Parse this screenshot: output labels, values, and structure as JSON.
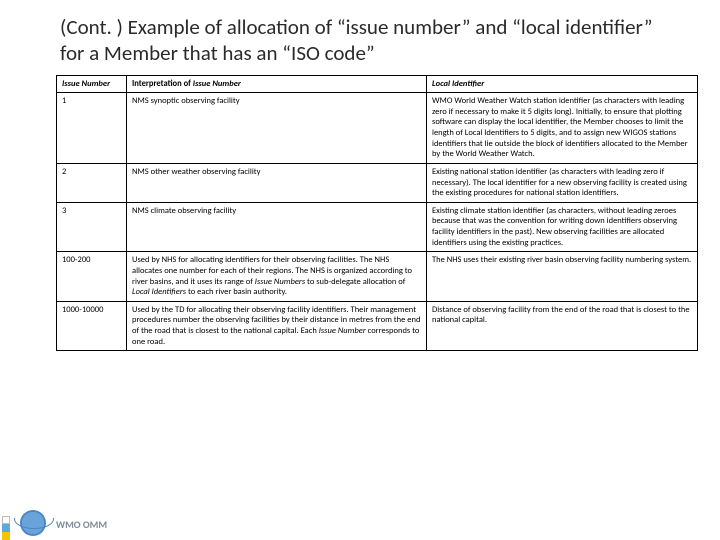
{
  "title": "(Cont. ) Example of allocation of “issue number” and “local identifier” for a Member that has an “ISO code”",
  "headers": {
    "col1": "Issue Number",
    "col2_prefix": "Interpretation of ",
    "col2_ital": "Issue Number",
    "col3": "Local Identifier"
  },
  "rows": [
    {
      "num": "1",
      "interp": "NMS synoptic observing facility",
      "local": "WMO World Weather Watch station identifier (as characters with leading zero if necessary to make it 5 digits long). Initially, to ensure that plotting software can display the local identifier, the Member chooses to limit the length of Local Identifiers to 5 digits, and to assign new WIGOS stations identifiers that lie outside the block of identifiers allocated to the Member by the World Weather Watch."
    },
    {
      "num": "2",
      "interp": "NMS other weather observing facility",
      "local": "Existing national station identifier (as characters with leading zero if necessary). The local identifier for a new observing facility is created using the existing procedures for national station identifiers."
    },
    {
      "num": "3",
      "interp": "NMS climate observing facility",
      "local": "Existing climate station identifier (as characters, without leading zeroes because that was the convention for writing down identifiers observing facility identifiers in the past). New observing facilities are allocated identifiers using the existing practices."
    },
    {
      "num": "100-200",
      "interp_a": "Used by NHS for allocating identifiers for their observing facilities. The NHS allocates one number for each of their regions. The NHS is organized according to river basins, and it uses its range of ",
      "interp_b": "Issue Numbers",
      "interp_c": " to sub-delegate allocation of ",
      "interp_d": "Local Identifiers",
      "interp_e": " to each river basin authority.",
      "local": "The NHS uses their existing river basin observing facility numbering system."
    },
    {
      "num": "1000-10000",
      "interp_a": "Used by the TD for allocating their observing facility identifiers. Their management procedures number the observing facilities by their distance in metres from the end of the road that is closest to the national capital. Each ",
      "interp_b": "Issue Number",
      "interp_c": " corresponds to one road.",
      "local": "Distance of observing facility from the end of the road that is closest to the national capital."
    }
  ],
  "brand": "WMO OMM"
}
